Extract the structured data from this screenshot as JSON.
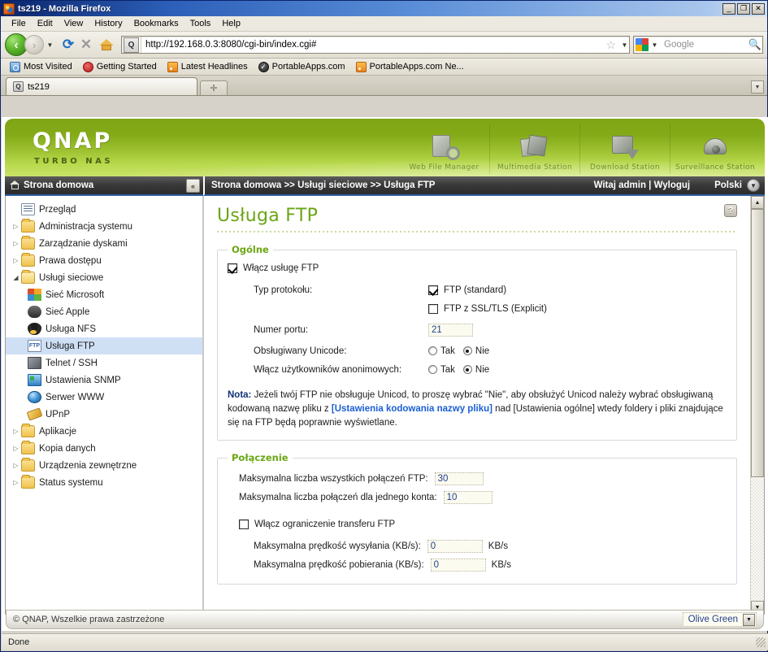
{
  "browser": {
    "title": "ts219 - Mozilla Firefox",
    "window_buttons": {
      "minimize": "_",
      "maximize": "❐",
      "close": "✕"
    },
    "menu": [
      "File",
      "Edit",
      "View",
      "History",
      "Bookmarks",
      "Tools",
      "Help"
    ],
    "url": "http://192.168.0.3:8080/cgi-bin/index.cgi#",
    "search_placeholder": "Google",
    "bookmarks": [
      {
        "label": "Most Visited",
        "icon": "globe-icon"
      },
      {
        "label": "Getting Started",
        "icon": "firefox-icon"
      },
      {
        "label": "Latest Headlines",
        "icon": "rss-icon"
      },
      {
        "label": "PortableApps.com",
        "icon": "check-circle-icon"
      },
      {
        "label": "PortableApps.com Ne...",
        "icon": "rss-icon"
      }
    ],
    "tab_label": "ts219",
    "new_tab_label": "✛",
    "status": "Done"
  },
  "banner": {
    "logo": "QNAP",
    "tagline": "TURBO NAS",
    "stations": [
      {
        "label": "Web File Manager",
        "icon": "file-search-icon"
      },
      {
        "label": "Multimedia Station",
        "icon": "film-icon"
      },
      {
        "label": "Download Station",
        "icon": "download-icon"
      },
      {
        "label": "Surveillance Station",
        "icon": "camera-icon"
      }
    ]
  },
  "header": {
    "home_label": "Strona domowa",
    "collapse_label": "«",
    "breadcrumb": "Strona domowa >> Usługi sieciowe >> Usługa FTP",
    "welcome": "Witaj admin | Wyloguj",
    "language": "Polski"
  },
  "sidebar": {
    "items": [
      {
        "label": "Przegląd",
        "icon": "document-icon",
        "twisty": "",
        "level": 1,
        "selected": false
      },
      {
        "label": "Administracja systemu",
        "icon": "folder-icon",
        "twisty": "▷",
        "level": 0,
        "selected": false
      },
      {
        "label": "Zarządzanie dyskami",
        "icon": "folder-icon",
        "twisty": "▷",
        "level": 0,
        "selected": false
      },
      {
        "label": "Prawa dostępu",
        "icon": "folder-icon",
        "twisty": "▷",
        "level": 0,
        "selected": false
      },
      {
        "label": "Usługi sieciowe",
        "icon": "folder-open-icon",
        "twisty": "◢",
        "level": 0,
        "selected": false
      },
      {
        "label": "Sieć Microsoft",
        "icon": "windows-icon",
        "twisty": "",
        "level": 1,
        "selected": false
      },
      {
        "label": "Sieć Apple",
        "icon": "apple-icon",
        "twisty": "",
        "level": 1,
        "selected": false
      },
      {
        "label": "Usługa NFS",
        "icon": "linux-penguin-icon",
        "twisty": "",
        "level": 1,
        "selected": false
      },
      {
        "label": "Usługa FTP",
        "icon": "ftp-icon",
        "twisty": "",
        "level": 1,
        "selected": true
      },
      {
        "label": "Telnet / SSH",
        "icon": "terminal-icon",
        "twisty": "",
        "level": 1,
        "selected": false
      },
      {
        "label": "Ustawienia SNMP",
        "icon": "snmp-network-icon",
        "twisty": "",
        "level": 1,
        "selected": false
      },
      {
        "label": "Serwer WWW",
        "icon": "globe-icon",
        "twisty": "",
        "level": 1,
        "selected": false
      },
      {
        "label": "UPnP",
        "icon": "upnp-plug-icon",
        "twisty": "",
        "level": 1,
        "selected": false
      },
      {
        "label": "Aplikacje",
        "icon": "folder-icon",
        "twisty": "▷",
        "level": 0,
        "selected": false
      },
      {
        "label": "Kopia danych",
        "icon": "folder-icon",
        "twisty": "▷",
        "level": 0,
        "selected": false
      },
      {
        "label": "Urządzenia zewnętrzne",
        "icon": "folder-icon",
        "twisty": "▷",
        "level": 0,
        "selected": false
      },
      {
        "label": "Status systemu",
        "icon": "folder-icon",
        "twisty": "▷",
        "level": 0,
        "selected": false
      }
    ]
  },
  "main": {
    "page_title": "Usługa FTP",
    "help_label": "?",
    "general": {
      "legend": "Ogólne",
      "enable_ftp": {
        "label": "Włącz usługę FTP",
        "checked": true
      },
      "protocol_label": "Typ protokołu:",
      "protocol_options": [
        {
          "label": "FTP (standard)",
          "checked": true
        },
        {
          "label": "FTP z SSL/TLS (Explicit)",
          "checked": false
        }
      ],
      "port_label": "Numer portu:",
      "port_value": "21",
      "unicode_label": "Obsługiwany Unicode:",
      "unicode_yes": "Tak",
      "unicode_no": "Nie",
      "unicode_selected": "Nie",
      "anonymous_label": "Włącz użytkowników anonimowych:",
      "anonymous_yes": "Tak",
      "anonymous_no": "Nie",
      "anonymous_selected": "Nie",
      "note_prefix": "Nota:",
      "note_part1": " Jeżeli twój FTP nie obsługuje Unicod, to proszę wybrać \"Nie\", aby obsłużyć Unicod należy wybrać obsługiwaną kodowaną nazwę pliku z ",
      "note_link": "[Ustawienia kodowania nazwy pliku]",
      "note_part2": " nad [Ustawienia ogólne] wtedy foldery i pliki znajdujące się na FTP będą poprawnie wyświetlane."
    },
    "connection": {
      "legend": "Połączenie",
      "max_total_label": "Maksymalna liczba wszystkich połączeń FTP:",
      "max_total_value": "30",
      "max_account_label": "Maksymalna liczba połączeń dla jednego konta:",
      "max_account_value": "10",
      "limit_transfer": {
        "label": "Włącz ograniczenie transferu FTP",
        "checked": false
      },
      "upload_label": "Maksymalna prędkość wysyłania (KB/s):",
      "upload_value": "0",
      "upload_unit": "KB/s",
      "download_label": "Maksymalna prędkość pobierania (KB/s):",
      "download_value": "0",
      "download_unit": "KB/s"
    }
  },
  "footer": {
    "copyright": "© QNAP, Wszelkie prawa zastrzeżone",
    "theme_value": "Olive Green"
  },
  "colors": {
    "qnap_green": "#6aa614",
    "banner_green_top": "#7fa515",
    "banner_green_bottom": "#c9e268",
    "selection_blue": "#cfe0f5",
    "field_text_blue": "#1f3f8f",
    "link_blue": "#1a5fd4"
  }
}
